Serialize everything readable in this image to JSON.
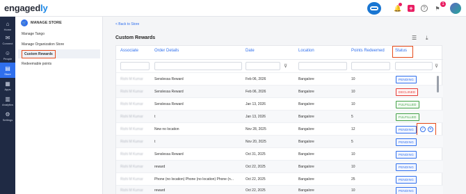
{
  "brand": {
    "name_main": "engaged",
    "name_accent": "ly"
  },
  "topbar": {
    "notifications_count": "1",
    "icons": [
      "chatbot-icon",
      "bell-icon",
      "plus-icon",
      "help-icon",
      "flag-icon",
      "avatar"
    ]
  },
  "leftnav": {
    "items": [
      {
        "label": "Home",
        "icon": "⌂"
      },
      {
        "label": "Connect",
        "icon": "✉"
      },
      {
        "label": "People",
        "icon": "☺"
      },
      {
        "label": "Store",
        "icon": "▤"
      },
      {
        "label": "Apps",
        "icon": "▦"
      },
      {
        "label": "Analytics",
        "icon": "▥"
      },
      {
        "label": "Settings",
        "icon": "⚙"
      }
    ]
  },
  "submenu": {
    "title": "MANAGE STORE",
    "items": [
      "Manage Tango",
      "Manage Organization Store",
      "Custom Rewards",
      "Redeemable points"
    ]
  },
  "content": {
    "back_link": "< Back to Store",
    "title": "Custom Rewards",
    "columns": [
      "Associate",
      "Order Details",
      "Date",
      "Location",
      "Points Redeemed",
      "Status"
    ],
    "rows": [
      {
        "associate": "Rishi M Kumar",
        "order": "Senslessa Reward",
        "date": "Feb 06, 2026",
        "location": "Bangalore",
        "points": "10",
        "status": "PENDING"
      },
      {
        "associate": "Rishi M Kumar",
        "order": "Senslessa Reward",
        "date": "Feb 06, 2026",
        "location": "Bangalore",
        "points": "10",
        "status": "DECLINED"
      },
      {
        "associate": "Rishi M Kumar",
        "order": "Senslessa Reward",
        "date": "Jan 13, 2026",
        "location": "Bangalore",
        "points": "10",
        "status": "FULFILLED"
      },
      {
        "associate": "Rishi M Kumar",
        "order": "t",
        "date": "Jan 13, 2026",
        "location": "Bangalore",
        "points": "5",
        "status": "FULFILLED"
      },
      {
        "associate": "Rishi M Kumar",
        "order": "New no location",
        "date": "Nov 28, 2025",
        "location": "Bangalore",
        "points": "12",
        "status": "PENDING"
      },
      {
        "associate": "Rishi M Kumar",
        "order": "t",
        "date": "Nov 20, 2025",
        "location": "Bangalore",
        "points": "5",
        "status": "PENDING"
      },
      {
        "associate": "Rishi M Kumar",
        "order": "Senslessa Reward",
        "date": "Oct 31, 2025",
        "location": "Bangalore",
        "points": "10",
        "status": "PENDING"
      },
      {
        "associate": "Rishi M Kumar",
        "order": "reward",
        "date": "Oct 22, 2025",
        "location": "Bangalore",
        "points": "10",
        "status": "PENDING"
      },
      {
        "associate": "Rishi M Kumar",
        "order": "Phone (no location) Phone (no location) Phone (n...",
        "date": "Oct 22, 2025",
        "location": "Bangalore",
        "points": "25",
        "status": "PENDING"
      },
      {
        "associate": "Rishi M Kumar",
        "order": "reward",
        "date": "Oct 22, 2025",
        "location": "Bangalore",
        "points": "10",
        "status": "PENDING"
      }
    ],
    "row_actions": {
      "approve_icon": "✓",
      "decline_icon": "✕"
    }
  },
  "colors": {
    "accent": "#2f6fed",
    "highlight": "#e64a19",
    "nav_bg": "#1f2a44"
  }
}
